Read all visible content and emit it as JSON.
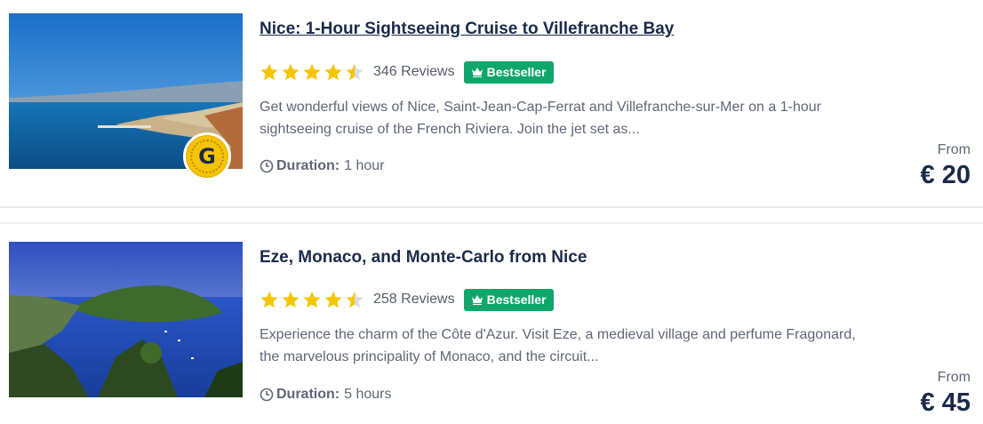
{
  "colors": {
    "star": "#f7c600",
    "bestseller_bg": "#0fa66b",
    "title": "#1a2b49",
    "muted": "#5f6776"
  },
  "listings": [
    {
      "title": "Nice: 1-Hour Sightseeing Cruise to Villefranche Bay",
      "rating_stars": 4.5,
      "reviews": "346 Reviews",
      "badge": "Bestseller",
      "description_line1": "Get wonderful views of Nice, Saint-Jean-Cap-Ferrat and Villefranche-sur-Mer on a 1-hour",
      "description_line2": "sightseeing cruise of the French Riviera. Join the jet set as...",
      "duration_label": "Duration:",
      "duration_value": "1 hour",
      "from_label": "From",
      "price": "€ 20",
      "coin_letter": "G",
      "image_icon": "coastal-harbour-photo"
    },
    {
      "title": "Eze, Monaco, and Monte-Carlo from Nice",
      "rating_stars": 4.5,
      "reviews": "258 Reviews",
      "badge": "Bestseller",
      "description_line1": "Experience the charm of the Côte d'Azur. Visit Eze, a medieval village and perfume Fragonard,",
      "description_line2": "the marvelous principality of Monaco, and the circuit...",
      "duration_label": "Duration:",
      "duration_value": "5 hours",
      "from_label": "From",
      "price": "€ 45",
      "image_icon": "bay-peninsula-photo"
    }
  ]
}
